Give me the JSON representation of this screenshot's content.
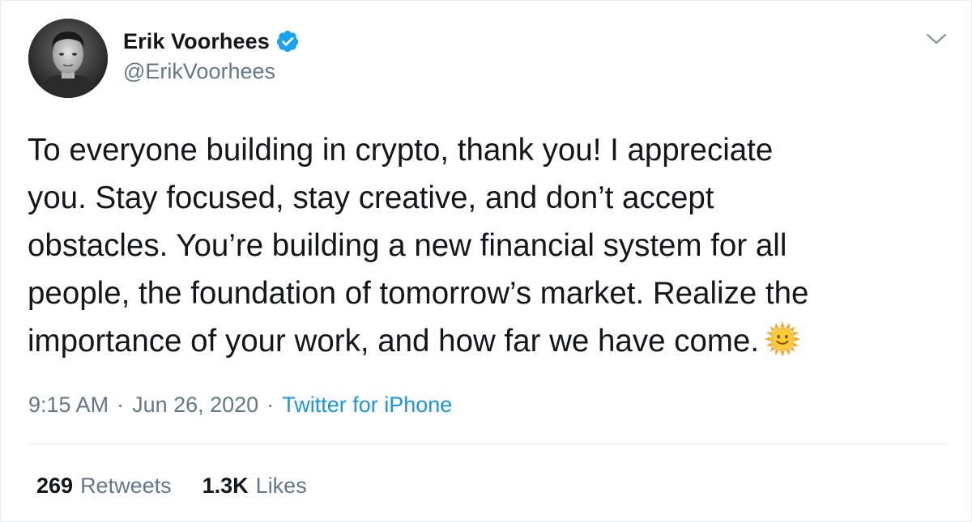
{
  "author": {
    "display_name": "Erik Voorhees",
    "handle": "@ErikVoorhees",
    "verified": true,
    "avatar_icon": "person-photo"
  },
  "tweet": {
    "lines": [
      "To everyone building in crypto, thank you! I appreciate",
      "you. Stay focused, stay creative, and don’t accept",
      "obstacles. You’re building a new financial system for all",
      "people, the foundation of tomorrow’s market. Realize the",
      "importance of your work, and how far we have come."
    ],
    "emoji": "sun-with-face-icon"
  },
  "meta": {
    "time": "9:15 AM",
    "separator": "·",
    "date": "Jun 26, 2020",
    "source": "Twitter for iPhone"
  },
  "stats": {
    "retweets_count": "269",
    "retweets_label": "Retweets",
    "likes_count": "1.3K",
    "likes_label": "Likes"
  },
  "colors": {
    "text": "#14171a",
    "secondary": "#657786",
    "link": "#1b95e0",
    "verified": "#1da1f2",
    "divider": "#e6ecf0"
  }
}
